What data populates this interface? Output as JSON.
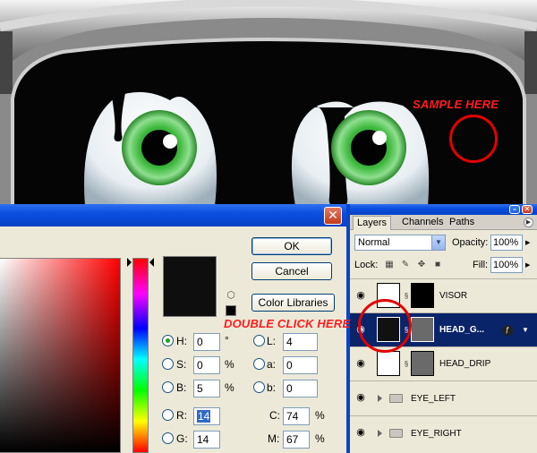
{
  "annotations": {
    "sample_here": "SAMPLE HERE",
    "double_click_here": "DOUBLE CLICK HERE",
    "accent_color": "#ff1c1c"
  },
  "color_picker": {
    "buttons": {
      "ok": "OK",
      "cancel": "Cancel",
      "color_libraries": "Color Libraries"
    },
    "current_color": "#0e0e0e",
    "hsb": [
      {
        "label": "H:",
        "value": "0",
        "unit": "°",
        "selected": true
      },
      {
        "label": "S:",
        "value": "0",
        "unit": "%",
        "selected": false
      },
      {
        "label": "B:",
        "value": "5",
        "unit": "%",
        "selected": false
      }
    ],
    "lab": [
      {
        "label": "L:",
        "value": "4"
      },
      {
        "label": "a:",
        "value": "0"
      },
      {
        "label": "b:",
        "value": "0"
      }
    ],
    "rgb": [
      {
        "label": "R:",
        "value": "14"
      },
      {
        "label": "G:",
        "value": "14"
      }
    ],
    "cmyk": [
      {
        "label": "C:",
        "value": "74",
        "unit": "%"
      },
      {
        "label": "M:",
        "value": "67",
        "unit": "%"
      }
    ]
  },
  "layers_panel": {
    "tabs": [
      "Layers",
      "Channels",
      "Paths"
    ],
    "blend_mode": "Normal",
    "opacity_label": "Opacity:",
    "opacity_value": "100%",
    "lock_label": "Lock:",
    "fill_label": "Fill:",
    "fill_value": "100%",
    "layers": [
      {
        "name": "VISOR",
        "type": "layer",
        "active": false
      },
      {
        "name": "HEAD_G...",
        "type": "layer",
        "active": true
      },
      {
        "name": "HEAD_DRIP",
        "type": "layer",
        "active": false
      },
      {
        "name": "EYE_LEFT",
        "type": "group",
        "active": false
      },
      {
        "name": "EYE_RIGHT",
        "type": "group",
        "active": false
      }
    ]
  }
}
